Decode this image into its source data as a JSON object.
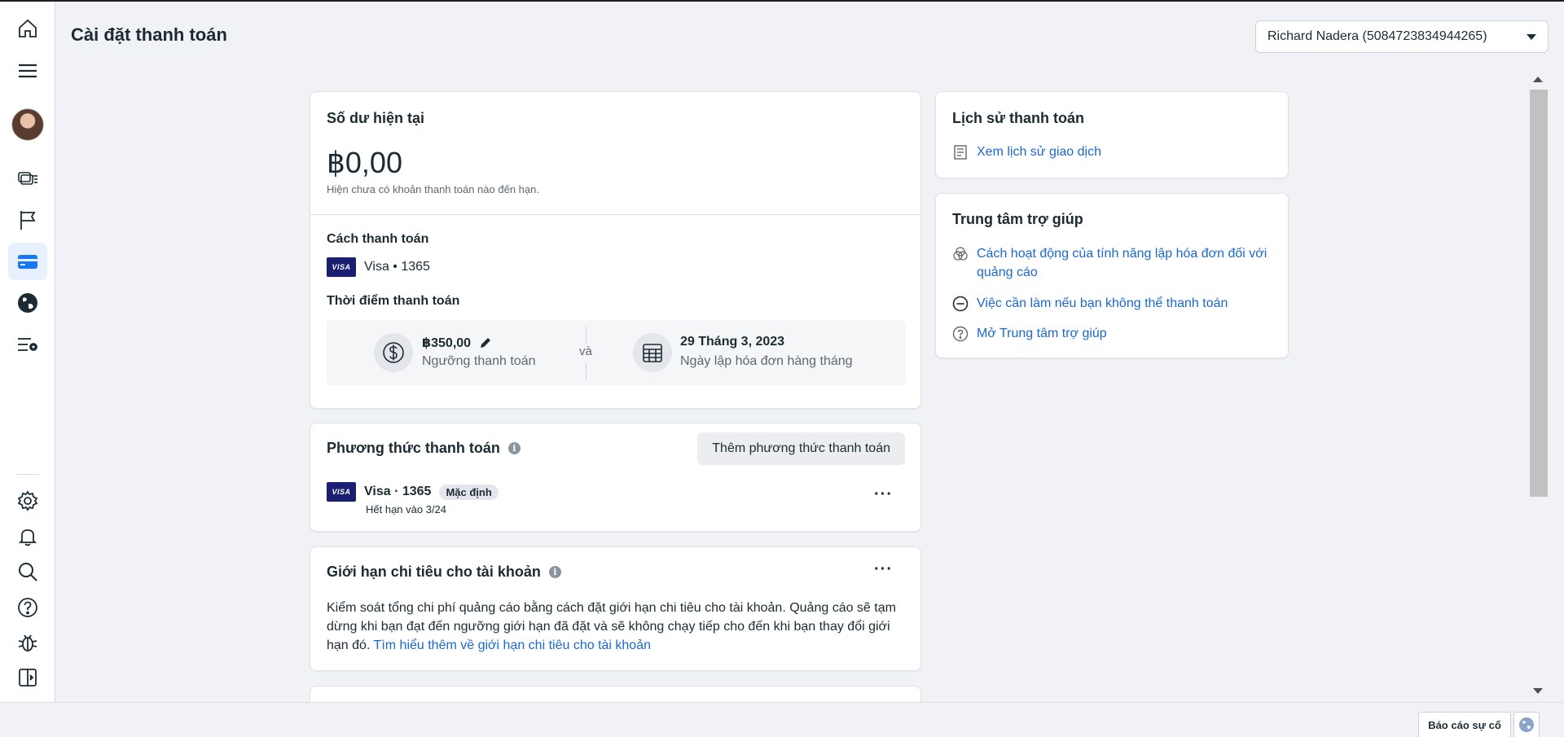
{
  "page": {
    "title": "Cài đặt thanh toán",
    "account_selector": "Richard Nadera (5084723834944265)"
  },
  "rail": {
    "icons": [
      "home-icon",
      "menu-icon",
      "avatar",
      "ads-manager-icon",
      "flag-icon",
      "billing-icon",
      "globe-icon",
      "settings-list-icon",
      "gear-icon",
      "bell-icon",
      "search-icon",
      "help-icon",
      "bug-icon",
      "sidebar-toggle-icon"
    ]
  },
  "balance": {
    "title": "Số dư hiện tại",
    "amount": "฿0,00",
    "note": "Hiện chưa có khoản thanh toán nào đến hạn.",
    "payment_method_label": "Cách thanh toán",
    "card_brand": "VISA",
    "card_text": "Visa • 1365",
    "timing_label": "Thời điểm thanh toán",
    "threshold_value": "฿350,00",
    "threshold_label": "Ngưỡng thanh toán",
    "and_text": "và",
    "billing_date": "29 Tháng 3, 2023",
    "billing_date_label": "Ngày lập hóa đơn hàng tháng"
  },
  "methods": {
    "title": "Phương thức thanh toán",
    "add_button": "Thêm phương thức thanh toán",
    "card_brand": "VISA",
    "card_text": "Visa · 1365",
    "default_badge": "Mặc định",
    "expiry": "Hết hạn vào 3/24",
    "more": "···"
  },
  "spend_limit": {
    "title": "Giới hạn chi tiêu cho tài khoản",
    "more": "···",
    "body": "Kiểm soát tổng chi phí quảng cáo bằng cách đặt giới hạn chi tiêu cho tài khoản. Quảng cáo sẽ tạm dừng khi bạn đạt đến ngưỡng giới hạn đã đặt và sẽ không chạy tiếp cho đến khi bạn thay đổi giới hạn đó.",
    "link": "Tìm hiểu thêm về giới hạn chi tiêu cho tài khoản"
  },
  "history": {
    "title": "Lịch sử thanh toán",
    "link": "Xem lịch sử giao dịch"
  },
  "help_center": {
    "title": "Trung tâm trợ giúp",
    "links": [
      "Cách hoạt động của tính năng lập hóa đơn đối với quảng cáo",
      "Việc cần làm nếu bạn không thể thanh toán",
      "Mở Trung tâm trợ giúp"
    ]
  },
  "footer": {
    "report_button": "Báo cáo sự cố"
  },
  "colors": {
    "accent": "#1b68d1",
    "visa": "#1a1f71",
    "background": "#f0f2f5"
  }
}
